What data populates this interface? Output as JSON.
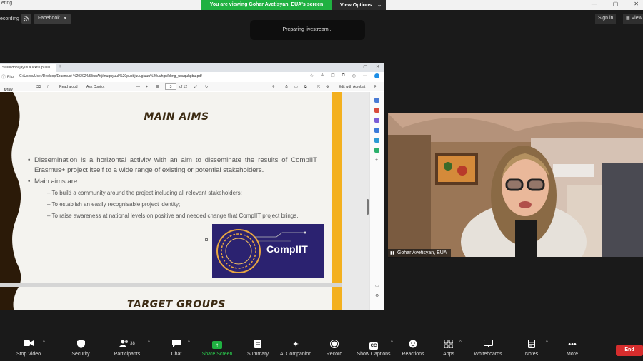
{
  "titlebar": {
    "window_title": "eting",
    "share_banner": "You are viewing Gohar Avetisyan, EUA's screen",
    "view_options": "View Options",
    "min_icon": "—",
    "max_icon": "▢",
    "close_icon": "✕"
  },
  "topbar": {
    "recording_label": "ecording",
    "facebook_label": "Facebook",
    "signin_label": "Sign in",
    "view_label": "View",
    "livestream_status": "Preparing livestream..."
  },
  "browser": {
    "tab_title": "Sliuulidbhujayus aucktuupuluu",
    "url_prefix": "File",
    "url": "C:/Users/User/Desktop/Erasmus+%202024/SliuuAttj/muquyuuli%20pupbjuuugluuu%20uuhgn/bbng_uuuquhpbu.pdf",
    "pdf_toolbar": {
      "draw": "Draw",
      "read_aloud": "Read aloud",
      "ask_copilot": "Ask Copilot",
      "minus": "—",
      "plus": "+",
      "page_current": "3",
      "page_total": "of 12",
      "edit_acrobat": "Edit with Acrobat"
    },
    "slide": {
      "heading": "MAIN AIMS",
      "bullet1": "Dissemination is a horizontal activity with an aim to disseminate the results of CompIIT Erasmus+ project itself to a wide range of existing or potential stakeholders.",
      "bullet2": "Main aims are:",
      "sub_items": [
        "To build a community around the project including all relevant stakeholders;",
        "To establish an easily recognisable project identity;",
        "To raise awareness at national levels on positive and needed change that CompIIT project brings."
      ],
      "logo_text": "CompIIT",
      "next_heading": "TARGET GROUPS"
    }
  },
  "camera": {
    "participant_name": "Gohar Avetisyan, EUA"
  },
  "toolbar": {
    "items": [
      {
        "label": "Stop Video",
        "icon": "video-camera-icon"
      },
      {
        "label": "Security",
        "icon": "shield-icon"
      },
      {
        "label": "Participants",
        "icon": "people-icon",
        "count": "38"
      },
      {
        "label": "Chat",
        "icon": "chat-bubble-icon"
      },
      {
        "label": "Share Screen",
        "icon": "share-screen-icon"
      },
      {
        "label": "Summary",
        "icon": "summary-icon"
      },
      {
        "label": "AI Companion",
        "icon": "sparkle-icon"
      },
      {
        "label": "Record",
        "icon": "record-icon"
      },
      {
        "label": "Show Captions",
        "icon": "cc-icon"
      },
      {
        "label": "Reactions",
        "icon": "emoji-icon"
      },
      {
        "label": "Apps",
        "icon": "apps-icon"
      },
      {
        "label": "Whiteboards",
        "icon": "whiteboard-icon"
      },
      {
        "label": "Notes",
        "icon": "notes-icon"
      },
      {
        "label": "More",
        "icon": "more-dots-icon"
      }
    ],
    "end_label": "End"
  },
  "colors": {
    "share_green": "#1fb141",
    "end_red": "#d62d2d",
    "slide_orange": "#f3b01f",
    "logo_purple": "#2b2270"
  }
}
